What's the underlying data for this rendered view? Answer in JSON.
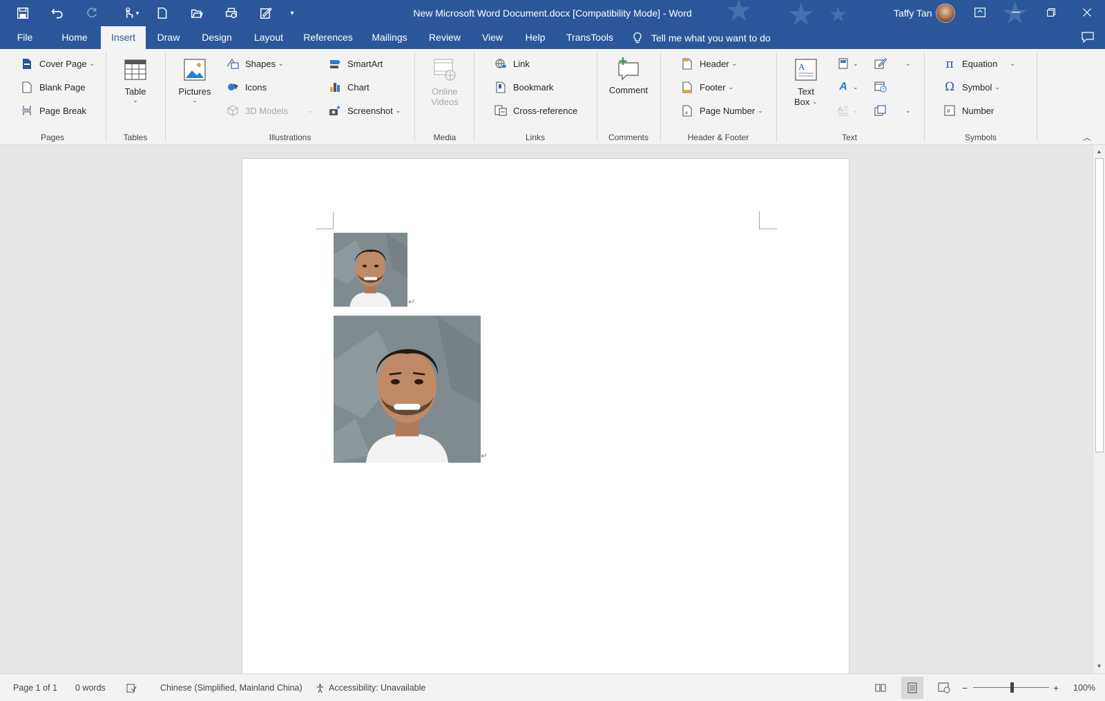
{
  "titlebar": {
    "document_title": "New Microsoft Word Document.docx [Compatibility Mode]  -  Word",
    "user_name": "Taffy Tan",
    "qat_icons": [
      "save-icon",
      "undo-icon",
      "redo-icon",
      "touch-mode-icon",
      "new-document-icon",
      "open-icon",
      "print-preview-icon",
      "edit-form-icon",
      "customize-qat-icon"
    ]
  },
  "tabs": [
    "File",
    "Home",
    "Insert",
    "Draw",
    "Design",
    "Layout",
    "References",
    "Mailings",
    "Review",
    "View",
    "Help",
    "TransTools"
  ],
  "active_tab": "Insert",
  "tell_me": "Tell me what you want to do",
  "ribbon": {
    "pages": {
      "label": "Pages",
      "cover_page": "Cover Page",
      "blank_page": "Blank Page",
      "page_break": "Page Break"
    },
    "tables": {
      "label": "Tables",
      "table": "Table"
    },
    "illustrations": {
      "label": "Illustrations",
      "pictures": "Pictures",
      "shapes": "Shapes",
      "icons": "Icons",
      "models": "3D Models",
      "smartart": "SmartArt",
      "chart": "Chart",
      "screenshot": "Screenshot"
    },
    "media": {
      "label": "Media",
      "online_videos_1": "Online",
      "online_videos_2": "Videos"
    },
    "links": {
      "label": "Links",
      "link": "Link",
      "bookmark": "Bookmark",
      "cross_reference": "Cross-reference"
    },
    "comments": {
      "label": "Comments",
      "comment": "Comment"
    },
    "header_footer": {
      "label": "Header & Footer",
      "header": "Header",
      "footer": "Footer",
      "page_number": "Page Number"
    },
    "text": {
      "label": "Text",
      "text_box_1": "Text",
      "text_box_2": "Box"
    },
    "symbols": {
      "label": "Symbols",
      "equation": "Equation",
      "symbol": "Symbol",
      "number": "Number"
    }
  },
  "statusbar": {
    "page": "Page 1 of 1",
    "words": "0 words",
    "language": "Chinese (Simplified, Mainland China)",
    "accessibility": "Accessibility: Unavailable",
    "zoom": "100%",
    "zoom_minus": "−",
    "zoom_plus": "+"
  },
  "colors": {
    "brand": "#2b579a",
    "ribbon_bg": "#f3f3f3",
    "canvas_bg": "#e6e6e6"
  }
}
